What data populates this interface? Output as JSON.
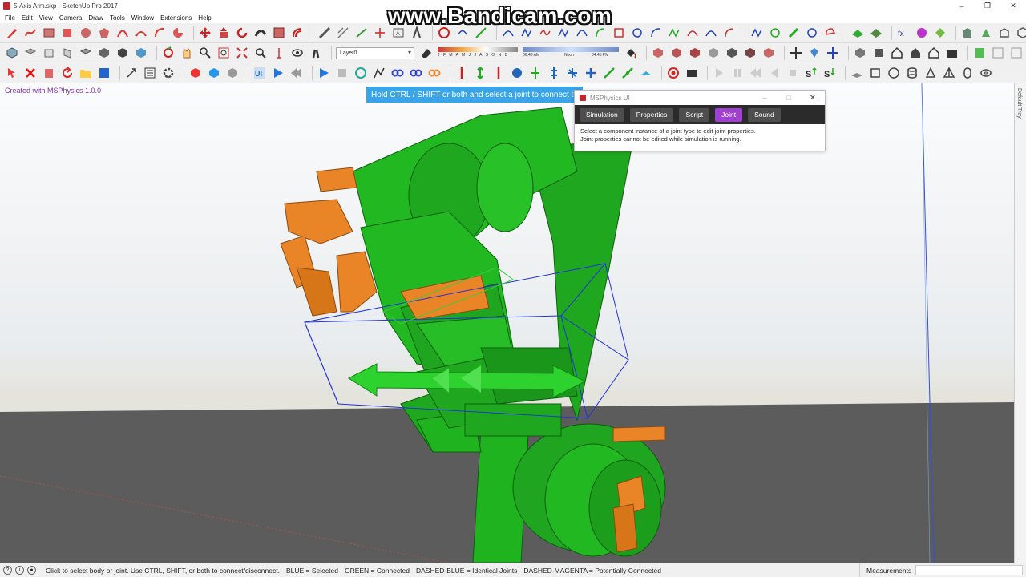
{
  "window": {
    "title": "5-Axis Arm.skp - SketchUp Pro 2017",
    "controls": [
      "–",
      "❐",
      "✕"
    ]
  },
  "menu": [
    "File",
    "Edit",
    "View",
    "Camera",
    "Draw",
    "Tools",
    "Window",
    "Extensions",
    "Help"
  ],
  "watermark": "www.Bandicam.com",
  "toolbar2": {
    "layer": "Layer0",
    "shadow_months": "J F M A M J J A S O N D",
    "shadow_time_start": "06:43 AM",
    "shadow_time_mid": "Noon",
    "shadow_time_end": "04:45 PM"
  },
  "viewport": {
    "created_with": "Created with MSPhysics 1.0.0",
    "hint": "Hold CTRL / SHIFT or both and select a joint to connect to"
  },
  "msphysics": {
    "title": "MSPhysics UI",
    "tabs": [
      {
        "label": "Simulation",
        "active": false
      },
      {
        "label": "Properties",
        "active": false
      },
      {
        "label": "Script",
        "active": false
      },
      {
        "label": "Joint",
        "active": true
      },
      {
        "label": "Sound",
        "active": false
      }
    ],
    "message_line1": "Select a component instance of a joint type to edit joint properties.",
    "message_line2": "Joint properties cannot be edited while simulation is running.",
    "accent": "#a040d0"
  },
  "tray": {
    "label": "Default Tray"
  },
  "status": {
    "text": "Click to select body or joint. Use CTRL, SHIFT, or both to connect/disconnect.",
    "legend": [
      "BLUE = Selected",
      "GREEN = Connected",
      "DASHED-BLUE = Identical Joints",
      "DASHED-MAGENTA = Potentially Connected"
    ],
    "measurements_label": "Measurements"
  },
  "colors": {
    "arm": "#22b422",
    "gripper": "#e98427",
    "selection": "#2233dd",
    "hint_bg": "#3aa4e8",
    "ground": "#5c5c5c"
  }
}
